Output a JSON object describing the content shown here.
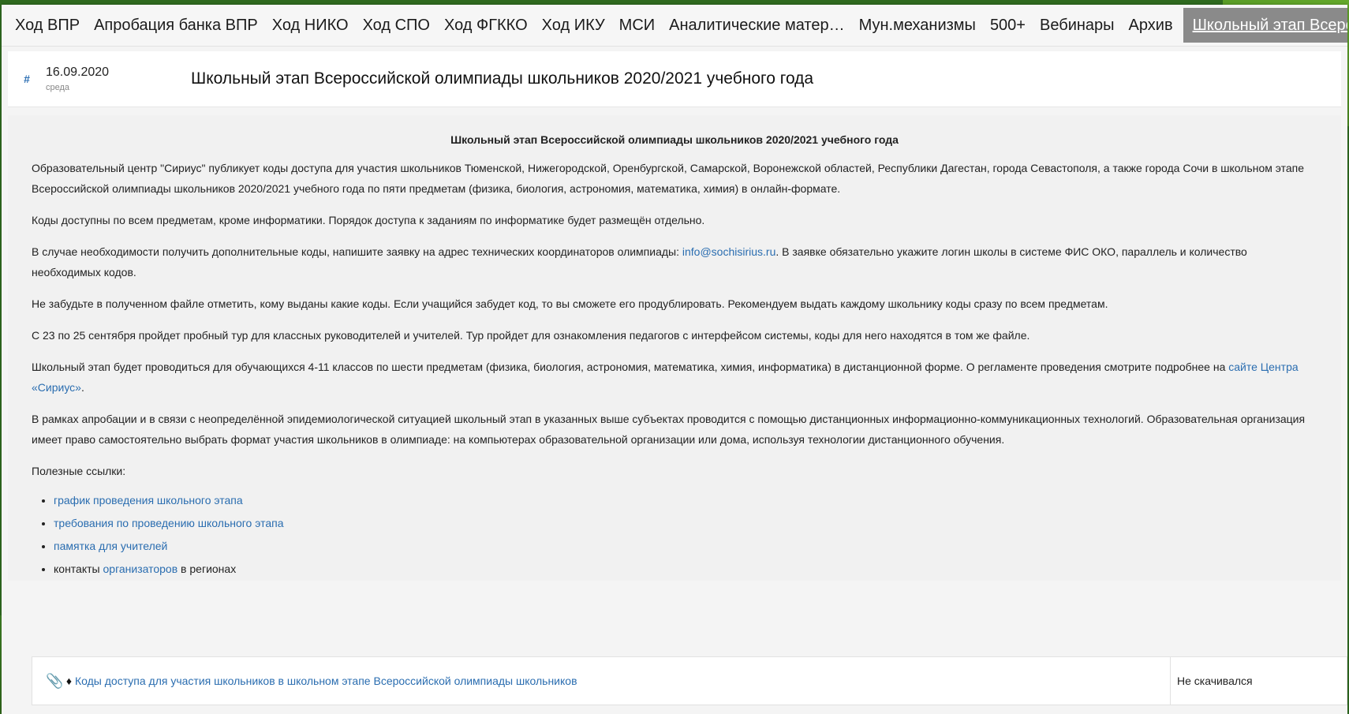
{
  "tabs": [
    {
      "label": "Ход ВПР"
    },
    {
      "label": "Апробация банка ВПР"
    },
    {
      "label": "Ход НИКО"
    },
    {
      "label": "Ход СПО"
    },
    {
      "label": "Ход ФГККО"
    },
    {
      "label": "Ход ИКУ"
    },
    {
      "label": "МСИ"
    },
    {
      "label": "Аналитические матер…"
    },
    {
      "label": "Мун.механизмы"
    },
    {
      "label": "500+"
    },
    {
      "label": "Вебинары"
    },
    {
      "label": "Архив"
    },
    {
      "label": "Школьный этап Всеро…"
    }
  ],
  "header": {
    "hash": "#",
    "date": "16.09.2020",
    "weekday": "среда",
    "title": "Школьный этап Всероссийской олимпиады школьников 2020/2021 учебного года"
  },
  "article": {
    "title": "Школьный этап Всероссийской олимпиады школьников 2020/2021 учебного года",
    "p1": "Образовательный центр \"Сириус\" публикует коды доступа для участия школьников Тюменской, Нижегородской, Оренбургской, Самарской, Воронежской областей, Республики Дагестан, города Севастополя, а также города Сочи в школьном этапе Всероссийской олимпиады школьников 2020/2021 учебного года по пяти предметам (физика, биология, астрономия, математика, химия) в онлайн-формате.",
    "p2": "Коды доступны по всем предметам, кроме информатики. Порядок доступа к заданиям по информатике будет размещён отдельно.",
    "p3_before": "В случае необходимости получить дополнительные коды, напишите заявку на адрес технических координаторов олимпиады: ",
    "p3_email": "info@sochisirius.ru",
    "p3_after": ". В заявке обязательно укажите логин школы в системе ФИС ОКО, параллель и количество необходимых кодов.",
    "p4": "Не забудьте в полученном файле отметить, кому выданы какие коды. Если учащийся забудет код, то вы сможете его продублировать. Рекомендуем выдать каждому школьнику коды сразу по всем предметам.",
    "p5": "С 23 по 25 сентября пройдет пробный тур для классных руководителей и учителей. Тур пройдет для ознакомления педагогов с интерфейсом системы, коды для него находятся в том же файле.",
    "p6_before": "Школьный этап будет проводиться для обучающихся 4-11 классов по шести предметам (физика, биология, астрономия, математика, химия, информатика) в дистанционной форме. О регламенте проведения смотрите подробнее на ",
    "p6_link": "сайте Центра «Сириус»",
    "p6_after": ".",
    "p7": "В рамках апробации и в связи с неопределённой эпидемиологической ситуацией школьный этап в указанных выше субъектах проводится с помощью дистанционных информационно-коммуникационных технологий. Образовательная организация имеет право самостоятельно выбрать формат участия школьников в олимпиаде: на компьютерах образовательной организации или дома, используя технологии дистанционного обучения.",
    "useful_label": "Полезные ссылки:",
    "links": [
      "график проведения школьного этапа",
      "требования по проведению школьного этапа",
      "памятка для учителей"
    ],
    "contacts_before": "контакты ",
    "contacts_link": "организаторов",
    "contacts_after": " в регионах"
  },
  "attachment": {
    "link": "Коды доступа для участия школьников в школьном этапе Всероссийской олимпиады школьников",
    "status": "Не скачивался"
  }
}
